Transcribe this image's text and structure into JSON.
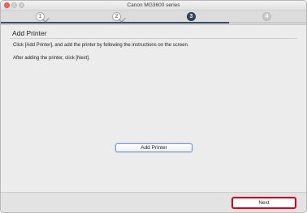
{
  "window": {
    "title": "Canon MG3600 series"
  },
  "steps": [
    {
      "number": "1",
      "state": "done"
    },
    {
      "number": "2",
      "state": "done"
    },
    {
      "number": "3",
      "state": "current"
    },
    {
      "number": "4",
      "state": "pending"
    }
  ],
  "page": {
    "heading": "Add Printer",
    "instruction": "Click [Add Printer], and add the printer by following the instructions on the screen.",
    "after_instruction": "After adding the printer, click [Next]."
  },
  "buttons": {
    "add_printer_label": "Add Printer",
    "next_label": "Next"
  },
  "colors": {
    "current_step": "#33435c",
    "highlight_border": "#e2001a"
  }
}
